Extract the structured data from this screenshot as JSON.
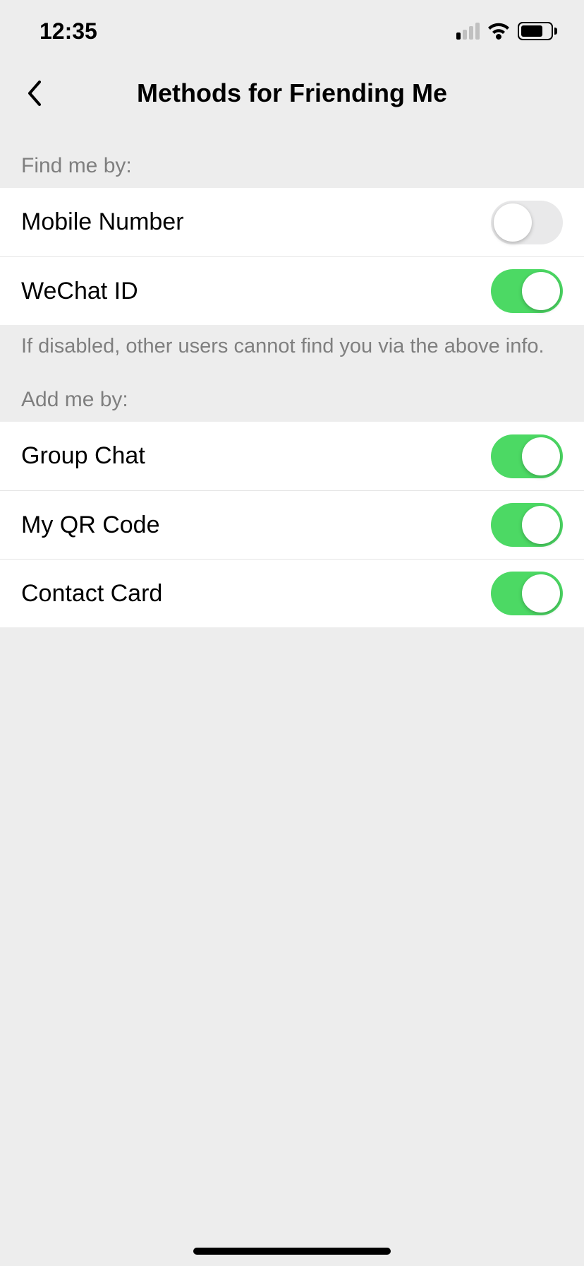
{
  "status": {
    "time": "12:35"
  },
  "nav": {
    "title": "Methods for Friending Me"
  },
  "sections": {
    "find_header": "Find me by:",
    "find_footer": "If disabled, other users cannot find you via the above info.",
    "add_header": "Add me by:"
  },
  "rows": {
    "mobile_number": {
      "label": "Mobile Number",
      "on": false
    },
    "wechat_id": {
      "label": "WeChat ID",
      "on": true
    },
    "group_chat": {
      "label": "Group Chat",
      "on": true
    },
    "qr_code": {
      "label": "My QR Code",
      "on": true
    },
    "contact_card": {
      "label": "Contact Card",
      "on": true
    }
  },
  "colors": {
    "toggle_on": "#4cd964",
    "toggle_off": "#e9e9ea",
    "bg": "#ededed"
  }
}
